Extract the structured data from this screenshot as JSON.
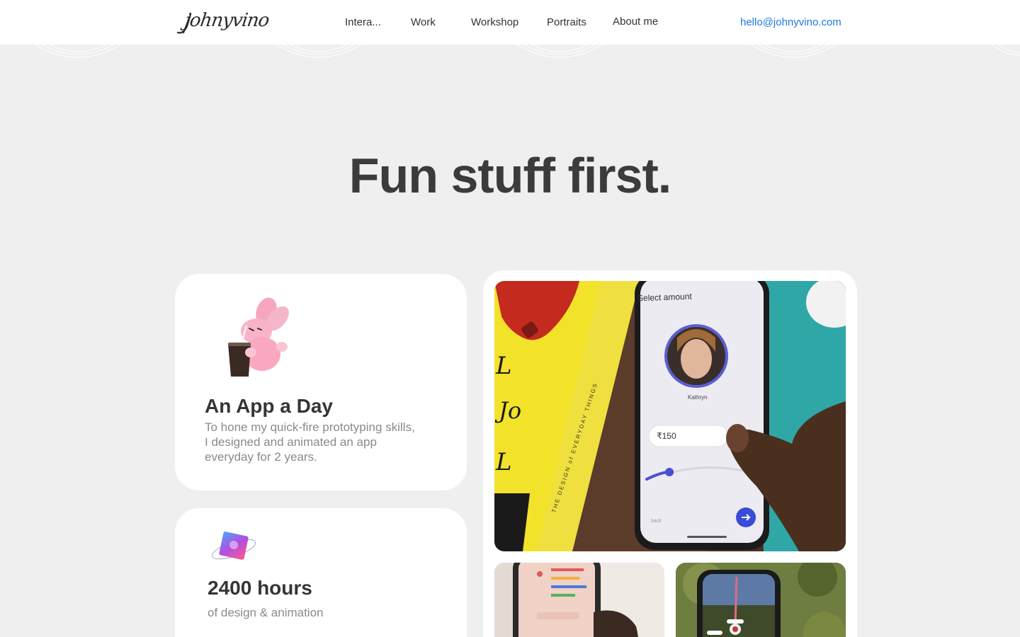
{
  "header": {
    "logo_text": "johnyvino",
    "nav": [
      {
        "label": "Intera..."
      },
      {
        "label": "Work"
      },
      {
        "label": "Workshop"
      },
      {
        "label": "Portraits"
      },
      {
        "label": "About me"
      }
    ],
    "email": "hello@johnyvino.com"
  },
  "hero": {
    "headline": "Fun stuff first."
  },
  "cards": {
    "app_a_day": {
      "title": "An App a Day",
      "description": "To hone my quick-fire prototyping skills, I designed and animated an app everyday for 2 years.",
      "icon": "bunny-drinking-icon"
    },
    "hours": {
      "title": "2400 hours",
      "subtitle": "of design & animation",
      "icon": "cube-icon"
    },
    "media": {
      "main_screen": {
        "heading": "Select amount",
        "name": "Kathryn",
        "amount": "₹150",
        "back_label": "back",
        "book_text_fragment_1": "L",
        "book_text_fragment_2": "Jo",
        "book_text_fragment_3": "L",
        "book_spine_text": "THE DESIGN of EVERYDAY THINGS"
      }
    }
  },
  "colors": {
    "background": "#efefef",
    "card": "#ffffff",
    "accent_link": "#1f7ae0",
    "heading": "#3b3b3b",
    "muted_text": "#8a8a8a"
  }
}
